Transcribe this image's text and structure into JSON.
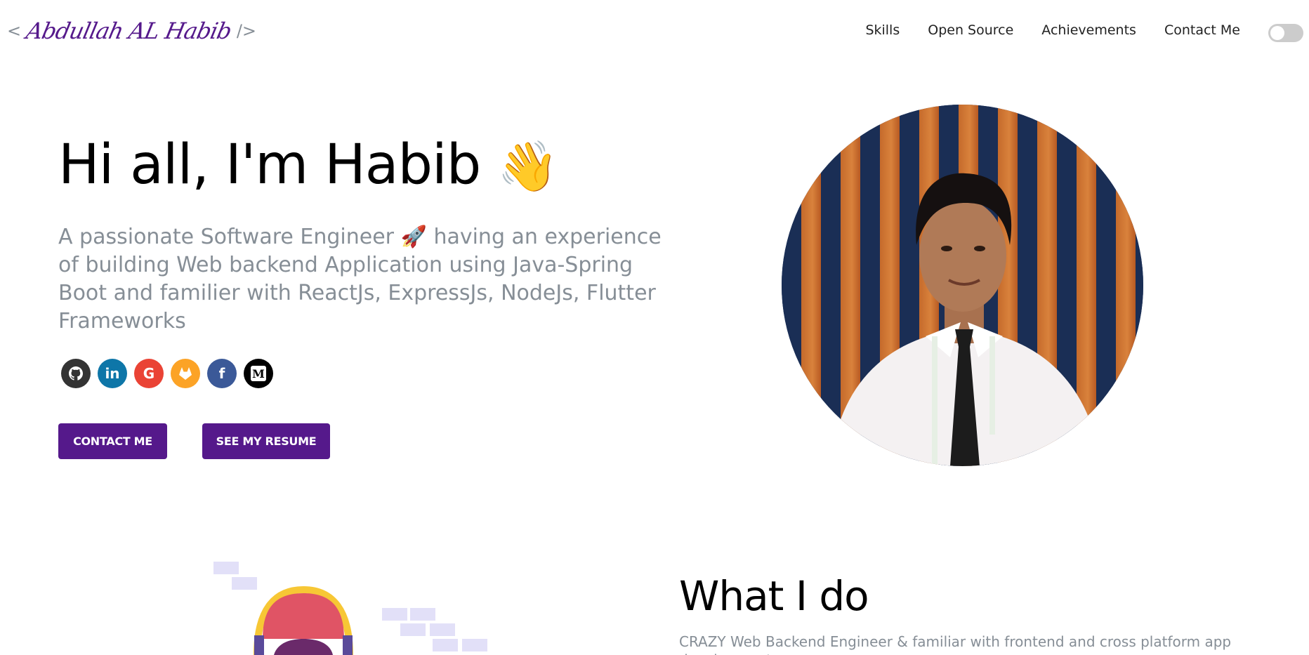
{
  "header": {
    "logo_open": "<",
    "logo_name": "Abdullah AL Habib",
    "logo_close": "/>",
    "nav": [
      {
        "label": "Skills"
      },
      {
        "label": "Open Source"
      },
      {
        "label": "Achievements"
      },
      {
        "label": "Contact Me"
      }
    ],
    "theme_toggle": {
      "state": "off"
    }
  },
  "hero": {
    "greeting": "Hi all, I'm Habib",
    "wave_emoji": "👋",
    "subtitle_before": "A passionate Software Engineer",
    "rocket_emoji": "🚀",
    "subtitle_after": "having an experience of building Web backend Application using Java-Spring Boot and familier with ReactJs, ExpressJs, NodeJs, Flutter Frameworks",
    "socials": [
      {
        "icon": "github-icon",
        "glyph": "⬤",
        "color": "#333333"
      },
      {
        "icon": "linkedin-icon",
        "glyph": "in",
        "color": "#0e76a8"
      },
      {
        "icon": "google-icon",
        "glyph": "G",
        "color": "#ea4335"
      },
      {
        "icon": "gitlab-icon",
        "glyph": "♦",
        "color": "#fca326"
      },
      {
        "icon": "facebook-icon",
        "glyph": "f",
        "color": "#3b5998"
      },
      {
        "icon": "medium-icon",
        "glyph": "M",
        "color": "#000000"
      }
    ],
    "buttons": {
      "contact": "CONTACT ME",
      "resume": "SEE MY RESUME"
    }
  },
  "what_i_do": {
    "title": "What I do",
    "subtitle": "CRAZY Web Backend Engineer & familiar with frontend and cross platform app development"
  },
  "colors": {
    "accent": "#55198b",
    "subtext": "#868e96"
  }
}
